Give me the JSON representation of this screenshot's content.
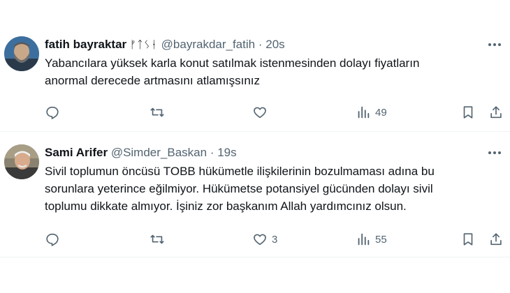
{
  "tweets": [
    {
      "name": "fatih bayraktar",
      "name_glyphs": "ᚠᛏᛊᚽ",
      "handle": "@bayrakdar_fatih",
      "separator": "·",
      "time": "20s",
      "text_lines": [
        "Yabancılara yüksek karla konut satılmak istenmesinden dolayı fiyatların",
        "anormal derecede artmasını atlamışsınız"
      ],
      "stats": {
        "replies": "",
        "retweets": "",
        "likes": "",
        "views": "49"
      },
      "icons": [
        "reply-icon",
        "retweet-icon",
        "like-icon",
        "views-icon",
        "bookmark-icon",
        "share-icon",
        "more-icon"
      ]
    },
    {
      "name": "Sami Arifer",
      "handle": "@Simder_Baskan",
      "separator": "·",
      "time": "19s",
      "text_lines": [
        "Sivil toplumun öncüsü TOBB hükümetle ilişkilerinin bozulmaması adına bu",
        "sorunlara yeterince eğilmiyor. Hükümetse potansiyel gücünden dolayı sivil",
        "toplumu dikkate almıyor. İşiniz zor başkanım Allah yardımcınız olsun."
      ],
      "stats": {
        "replies": "",
        "retweets": "",
        "likes": "3",
        "views": "55"
      },
      "icons": [
        "reply-icon",
        "retweet-icon",
        "like-icon",
        "views-icon",
        "bookmark-icon",
        "share-icon",
        "more-icon"
      ]
    }
  ],
  "colors": {
    "text": "#0f1419",
    "secondary": "#536471",
    "divider": "#eff3f4"
  }
}
